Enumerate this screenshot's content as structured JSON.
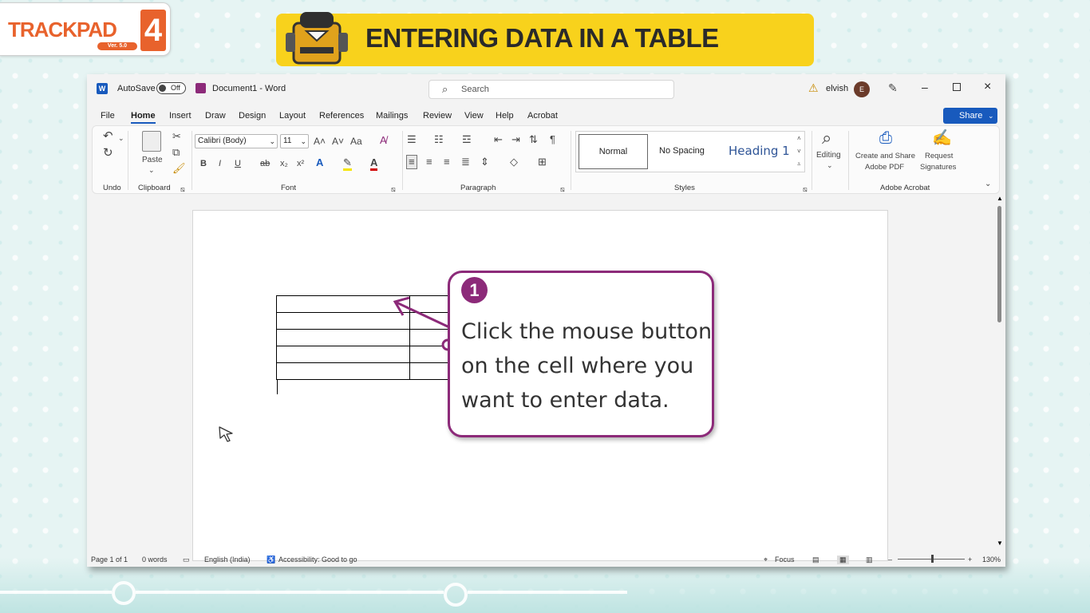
{
  "logo": {
    "text": "TRACKPAD",
    "version": "Ver. 5.0",
    "number": "4"
  },
  "banner": {
    "title": "ENTERING DATA IN A TABLE"
  },
  "titlebar": {
    "autosave": "AutoSave",
    "toggle_state": "Off",
    "document": "Document1 - Word",
    "search_placeholder": "Search",
    "user": "elvish",
    "avatar_initial": "E"
  },
  "menu": {
    "items": [
      "File",
      "Home",
      "Insert",
      "Draw",
      "Design",
      "Layout",
      "References",
      "Mailings",
      "Review",
      "View",
      "Help",
      "Acrobat"
    ],
    "share": "Share"
  },
  "ribbon": {
    "undo_label": "Undo",
    "clipboard_label": "Clipboard",
    "paste_label": "Paste",
    "font_name": "Calibri (Body)",
    "font_size": "11",
    "font_label": "Font",
    "paragraph_label": "Paragraph",
    "styles": {
      "normal": "Normal",
      "no_spacing": "No Spacing",
      "heading1": "Heading 1"
    },
    "styles_label": "Styles",
    "editing_label": "Editing",
    "acrobat_create": "Create and Share",
    "acrobat_create2": "Adobe PDF",
    "acrobat_request": "Request",
    "acrobat_request2": "Signatures",
    "acrobat_label": "Adobe Acrobat",
    "font_buttons": {
      "bold": "B",
      "italic": "I",
      "underline": "U",
      "strike": "ab",
      "subscript": "x₂",
      "superscript": "x²",
      "grow": "A˄",
      "shrink": "A˅",
      "case": "Aa"
    }
  },
  "status": {
    "page": "Page 1 of 1",
    "words": "0 words",
    "language": "English (India)",
    "accessibility": "Accessibility: Good to go",
    "focus": "Focus",
    "zoom": "130%"
  },
  "callout": {
    "number": "1",
    "text": "Click the mouse button on the cell where you want to enter data."
  },
  "colors": {
    "accent": "#185abd",
    "callout": "#8c2a79",
    "banner": "#f8d21c",
    "logo": "#e8622c"
  }
}
